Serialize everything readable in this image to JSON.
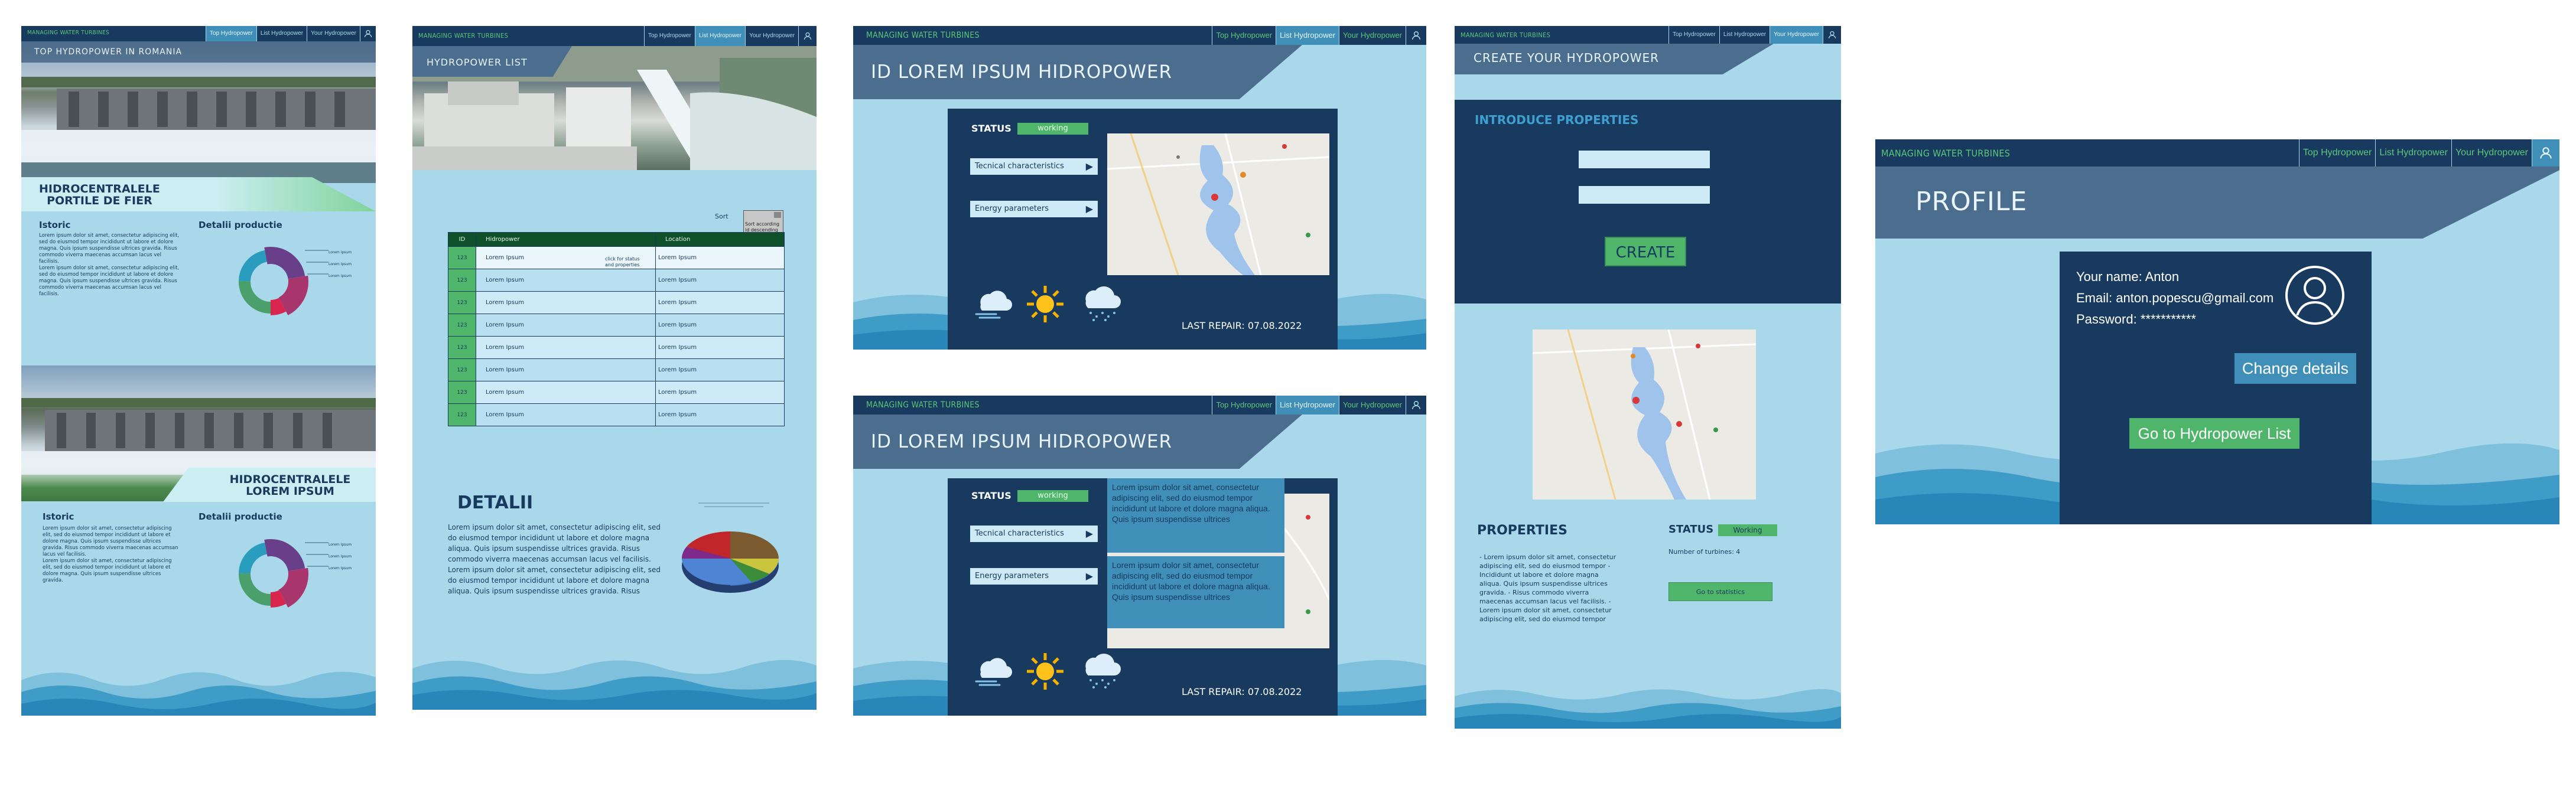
{
  "nav": {
    "brand": "MANAGING WATER TURBINES",
    "tab_top": "Top Hydropower",
    "tab_list": "List Hydropower",
    "tab_your": "Your Hydropower"
  },
  "top": {
    "banner": "TOP HYDROPOWER IN ROMANIA",
    "card1_title_line1": "HIDROCENTRALELE",
    "card1_title_line2": "PORTILE DE FIER",
    "card2_title_line1": "HIDROCENTRALELE",
    "card2_title_line2": "LOREM IPSUM",
    "istoric": "Istoric",
    "detalii_productie": "Detalii productie",
    "lorem_para": "Lorem ipsum dolor sit amet, consectetur adipiscing elit, sed do eiusmod tempor incididunt ut labore et dolore magna. Quis ipsum suspendisse ultrices gravida. Risus commodo viverra maecenas accumsan lacus vel facilisis.",
    "lorem_para2": "Lorem ipsum dolor sit amet, consectetur adipiscing elit, sed do eiusmod tempor incididunt ut labore et dolore magna. Quis ipsum suspendisse ultrices gravida. Risus commodo viverra maecenas accumsan lacus vel facilisis.",
    "lorem_para3": "Lorem ipsum dolor sit amet, consectetur adipiscing elit, sed do eiusmod tempor incididunt ut labore et dolore magna. Quis ipsum suspendisse ultrices gravida.",
    "legend": [
      "Lorem Ipsum",
      "Lorem Ipsum",
      "Lorem Ipsum"
    ]
  },
  "list": {
    "banner": "HYDROPOWER LIST",
    "sort": "Sort",
    "sort_tooltip": "Sort according id descending alpha to/z name location",
    "col_id": "ID",
    "col_name": "Hidropower",
    "col_location": "Location",
    "row_id": "123",
    "row_text": "Lorem Ipsum",
    "row_count": 8,
    "click_hint": "click for status and properties",
    "detalii": "DETALII",
    "detalii_text": "Lorem ipsum dolor sit amet, consectetur adipiscing elit, sed do eiusmod tempor incididunt ut labore et dolore magna aliqua. Quis ipsum suspendisse ultrices gravida. Risus commodo viverra maecenas accumsan lacus vel facilisis. Lorem ipsum dolor sit amet, consectetur adipiscing elit, sed do eiusmod tempor incididunt ut labore et dolore magna aliqua. Quis ipsum suspendisse ultrices gravida. Risus"
  },
  "detail": {
    "banner": "ID LOREM IPSUM HIDROPOWER",
    "status_label": "STATUS",
    "status_value": "working",
    "tech_button": "Tecnical characteristics",
    "energy_button": "Energy parameters",
    "last_repair": "LAST REPAIR: 07.08.2022",
    "popup_text": "Lorem ipsum dolor sit amet, consectetur adipiscing elit, sed do eiusmod tempor incididunt ut labore et dolore magna aliqua. Quis ipsum suspendisse ultrices"
  },
  "create": {
    "banner": "CREATE YOUR HYDROPOWER",
    "introduce": "INTRODUCE PROPERTIES",
    "create_button": "CREATE",
    "properties": "PROPERTIES",
    "props_text": "- Lorem ipsum dolor sit amet, consectetur adipiscing elit, sed do eiusmod tempor - Incididunt ut labore et dolore magna aliqua. Quis ipsum suspendisse ultrices gravida. - Risus commodo viverra maecenas accumsan lacus vel facilisis. - Lorem ipsum dolor sit amet, consectetur adipiscing elit, sed do eiusmod tempor",
    "status_label": "STATUS",
    "status_value": "Working",
    "turbines": "Number of turbines: 4",
    "stats_button": "Go to statistics"
  },
  "profile": {
    "banner": "PROFILE",
    "name": "Your name: Anton",
    "email": "Email: anton.popescu@gmail.com",
    "password": "Password: ***********",
    "change_button": "Change details",
    "list_button": "Go to Hydropower List"
  },
  "colors": {
    "navy": "#173a5e",
    "sky": "#a9d8ea",
    "green": "#4fb56b",
    "banner": "#4b6e8e",
    "accent_blue": "#3f8fb8"
  }
}
